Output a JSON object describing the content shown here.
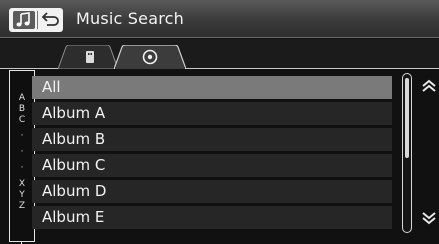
{
  "header": {
    "title": "Music Search",
    "icons": [
      "music-note-icon",
      "back-icon"
    ]
  },
  "tabs": [
    {
      "name": "usb",
      "icon": "usb-icon",
      "active": false
    },
    {
      "name": "disc",
      "icon": "disc-icon",
      "active": true
    }
  ],
  "alpha_index": [
    "A",
    "B",
    "C",
    "·",
    "·",
    "·",
    "X",
    "Y",
    "Z"
  ],
  "list": {
    "items": [
      {
        "label": "All",
        "selected": true
      },
      {
        "label": "Album A",
        "selected": false
      },
      {
        "label": "Album B",
        "selected": false
      },
      {
        "label": "Album C",
        "selected": false
      },
      {
        "label": "Album D",
        "selected": false
      },
      {
        "label": "Album E",
        "selected": false
      }
    ]
  },
  "scroll": {
    "up_icon": "double-chevron-up-icon",
    "down_icon": "double-chevron-down-icon",
    "position": 0.0
  },
  "colors": {
    "background": "#111111",
    "row": "#262626",
    "row_selected": "#7a7a7a",
    "text": "#f2f2f2"
  }
}
